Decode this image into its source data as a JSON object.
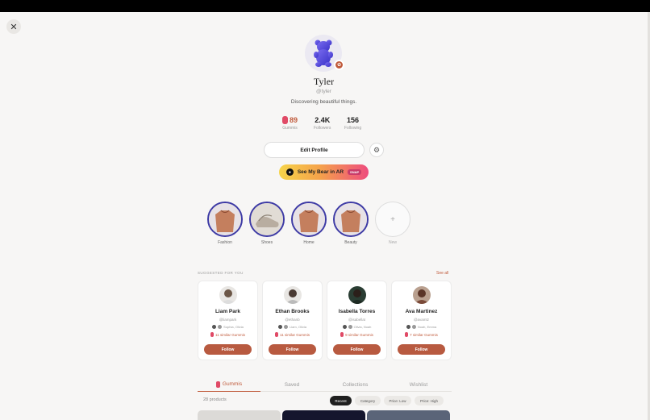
{
  "profile": {
    "name": "Tyler",
    "handle": "@tyler",
    "bio": "Discovering beautiful things.",
    "stats": {
      "gummies": {
        "value": "89",
        "label": "Gummis"
      },
      "followers": {
        "value": "2.4K",
        "label": "Followers"
      },
      "following": {
        "value": "156",
        "label": "Following"
      }
    },
    "edit_label": "Edit Profile",
    "ar_label": "See My Bear in AR",
    "ar_tag": "SNAP"
  },
  "collections": [
    {
      "label": "Fashion"
    },
    {
      "label": "Shoes"
    },
    {
      "label": "Home"
    },
    {
      "label": "Beauty"
    },
    {
      "label": "New"
    }
  ],
  "suggested": {
    "title": "SUGGESTED FOR YOU",
    "see_all": "See all",
    "cards": [
      {
        "name": "Liam Park",
        "handle": "@liampark",
        "mutual": "Sophia, Olivia",
        "similar": "11 similar Gummis",
        "follow": "Follow"
      },
      {
        "name": "Ethan Brooks",
        "handle": "@ethanb",
        "mutual": "Liam, Olivia",
        "similar": "11 similar Gummis",
        "follow": "Follow"
      },
      {
        "name": "Isabella Torres",
        "handle": "@isabellat",
        "mutual": "Olivia, Noah",
        "similar": "9 similar Gummis",
        "follow": "Follow"
      },
      {
        "name": "Ava Martinez",
        "handle": "@avamtz",
        "mutual": "Noah, Emma",
        "similar": "7 similar Gummis",
        "follow": "Follow"
      }
    ]
  },
  "tabs": [
    {
      "label": "Gummis"
    },
    {
      "label": "Saved"
    },
    {
      "label": "Collections"
    },
    {
      "label": "Wishlist"
    }
  ],
  "products": {
    "count": "28 products",
    "filters": [
      "Recent",
      "Category",
      "Price: Low",
      "Price: High"
    ]
  },
  "colors": {
    "accent": "#c05a3b",
    "collection_ring": "#3d3aa5",
    "follow_button": "#b85a40"
  }
}
